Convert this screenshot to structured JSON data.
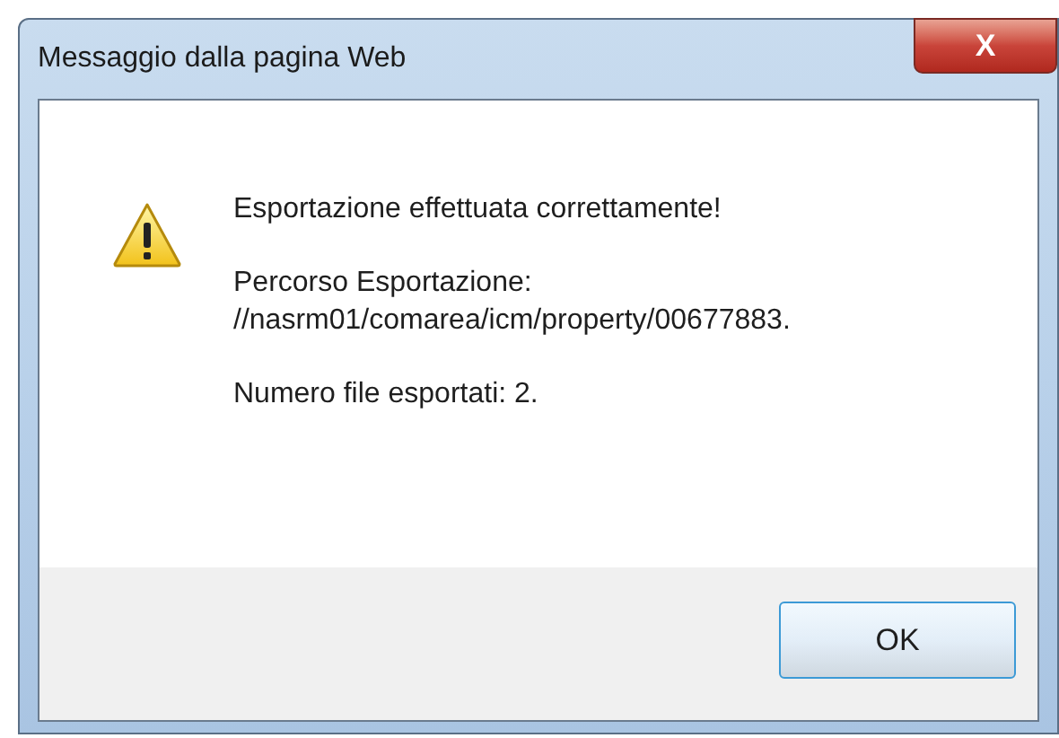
{
  "window": {
    "title": "Messaggio dalla pagina Web",
    "close": "X"
  },
  "message": {
    "paragraphs": [
      [
        "Esportazione effettuata correttamente!"
      ],
      [
        "Percorso Esportazione:",
        "//nasrm01/comarea/icm/property/00677883."
      ],
      [
        "Numero file esportati: 2."
      ]
    ]
  },
  "buttons": [
    {
      "label": "OK"
    }
  ]
}
